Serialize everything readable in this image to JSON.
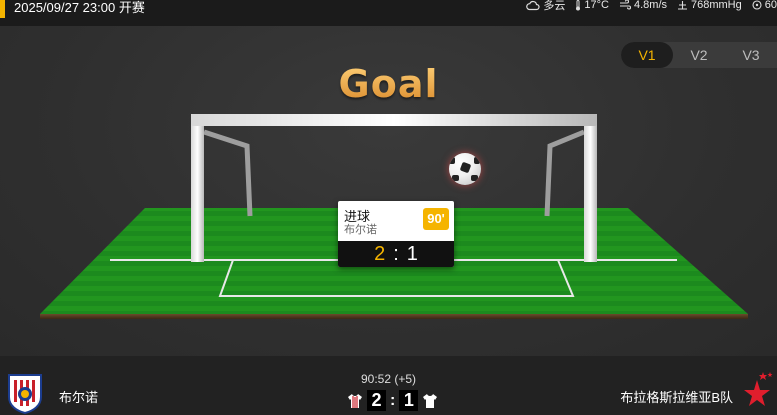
{
  "header": {
    "match_info": "2025/09/27 23:00 开赛",
    "weather": "多云",
    "temperature": "17°C",
    "wind": "4.8m/s",
    "pressure": "768mmHg",
    "humidity": "60"
  },
  "version_tabs": [
    {
      "label": "V1",
      "active": true
    },
    {
      "label": "V2",
      "active": false
    },
    {
      "label": "V3",
      "active": false
    }
  ],
  "animation": {
    "title": "Goal",
    "event_type": "进球",
    "event_team": "布尔诺",
    "event_minute": "90'",
    "home_score": "2",
    "score_separator": ":",
    "away_score": "1"
  },
  "footer": {
    "home_team": "布尔诺",
    "away_team": "布拉格斯拉维亚B队",
    "match_clock": "90:52 (+5)",
    "home_score": "2",
    "away_score": "1",
    "separator": ":"
  },
  "colors": {
    "accent": "#f5b400",
    "pitch": "#1f8a1f",
    "home_kit": "#c8202a",
    "away_kit": "#ffffff"
  }
}
